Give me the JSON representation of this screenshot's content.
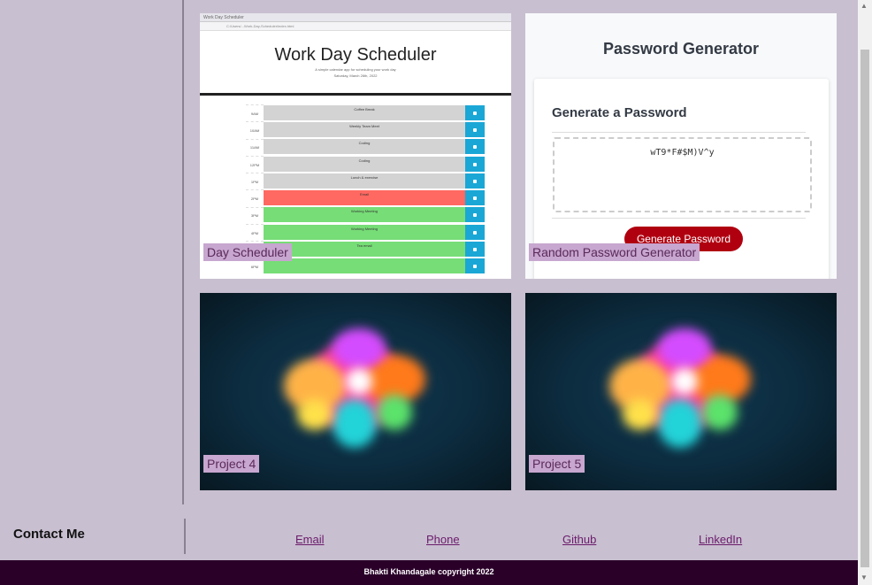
{
  "projects": [
    {
      "label": "Day Scheduler"
    },
    {
      "label": "Random Password Generator"
    },
    {
      "label": "Project 4"
    },
    {
      "label": "Project 5"
    }
  ],
  "scheduler_preview": {
    "tab": "Work Day Scheduler",
    "url": "C:/Users/...Work-Day-Scheduler/index.html",
    "title": "Work Day Scheduler",
    "subtitle": "A simple calendar app for scheduling your work day",
    "date": "Saturday, March 26th, 2022",
    "hours": [
      {
        "hour": "9AM",
        "event": "Coffee Break",
        "state": "past"
      },
      {
        "hour": "10AM",
        "event": "Weekly Team Meet",
        "state": "past"
      },
      {
        "hour": "11AM",
        "event": "Coding",
        "state": "past"
      },
      {
        "hour": "12PM",
        "event": "Coding",
        "state": "past"
      },
      {
        "hour": "1PM",
        "event": "Lunch & exercise",
        "state": "past"
      },
      {
        "hour": "2PM",
        "event": "Email",
        "state": "present"
      },
      {
        "hour": "3PM",
        "event": "Working Meeting",
        "state": "future"
      },
      {
        "hour": "4PM",
        "event": "Working Meeting",
        "state": "future"
      },
      {
        "hour": "5PM",
        "event": "Tea email",
        "state": "future"
      },
      {
        "hour": "6PM",
        "event": "",
        "state": "future"
      }
    ]
  },
  "password_preview": {
    "header": "Password Generator",
    "card_title": "Generate a Password",
    "password": "wT9*F#$M)V^y",
    "button": "Generate Password"
  },
  "contact": {
    "title": "Contact Me",
    "links": [
      "Email",
      "Phone",
      "Github",
      "LinkedIn"
    ]
  },
  "footer": "Bhakti Khandagale copyright 2022",
  "colors": {
    "page_bg": "#c8bfd0",
    "footer_bg": "#2a0029",
    "label_bg": "#c7a6cf",
    "link": "#6b1b6b"
  }
}
